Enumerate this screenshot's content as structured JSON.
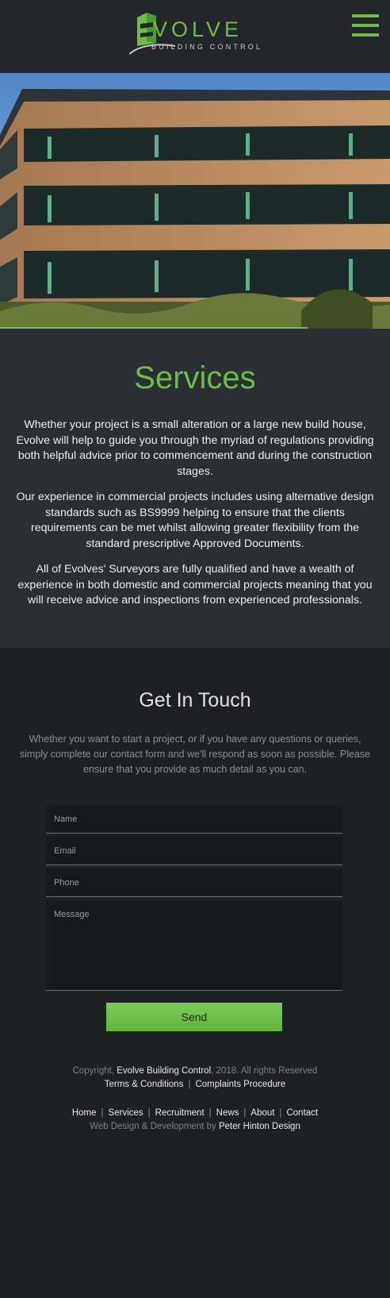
{
  "header": {
    "logo_word": "VOLVE",
    "logo_initial": "E",
    "logo_subtitle": "BUILDING CONTROL",
    "menu_icon": "hamburger-menu-icon"
  },
  "hero": {
    "alt": "office building photo"
  },
  "services": {
    "title": "Services",
    "paragraphs": [
      "Whether your project is a small alteration or a large new build house, Evolve will help to guide you through the myriad of regulations providing both helpful advice prior to commencement and during the construction stages.",
      "Our experience in commercial projects includes using alternative design standards such as BS9999 helping to ensure that the clients requirements can be met whilst allowing greater flexibility from the standard prescriptive Approved Documents.",
      "All of Evolves' Surveyors are fully qualified and have a wealth of experience in both domestic and commercial projects meaning that you will receive advice and inspections from experienced professionals."
    ]
  },
  "contact": {
    "title": "Get In Touch",
    "intro": "Whether you want to start a project, or if you have any questions or queries, simply complete our contact form and we'll respond as soon as possible. Please ensure that you provide as much detail as you can.",
    "form": {
      "name_placeholder": "Name",
      "email_placeholder": "Email",
      "phone_placeholder": "Phone",
      "message_placeholder": "Message",
      "send_label": "Send"
    }
  },
  "footer": {
    "copyright_prefix": "Copyright,",
    "company": "Evolve Building Control",
    "copyright_suffix": ", 2018. All rights Reserved",
    "terms": "Terms & Conditions",
    "complaints": "Complaints Procedure",
    "nav": [
      "Home",
      "Services",
      "Recruitment",
      "News",
      "About",
      "Contact"
    ],
    "credit_prefix": "Web Design & Development by",
    "credit_name": "Peter Hinton Design"
  },
  "colors": {
    "accent": "#6cbf45",
    "header_bg": "#24262b",
    "services_bg": "#2b2e35",
    "page_bg": "#1f2022"
  }
}
